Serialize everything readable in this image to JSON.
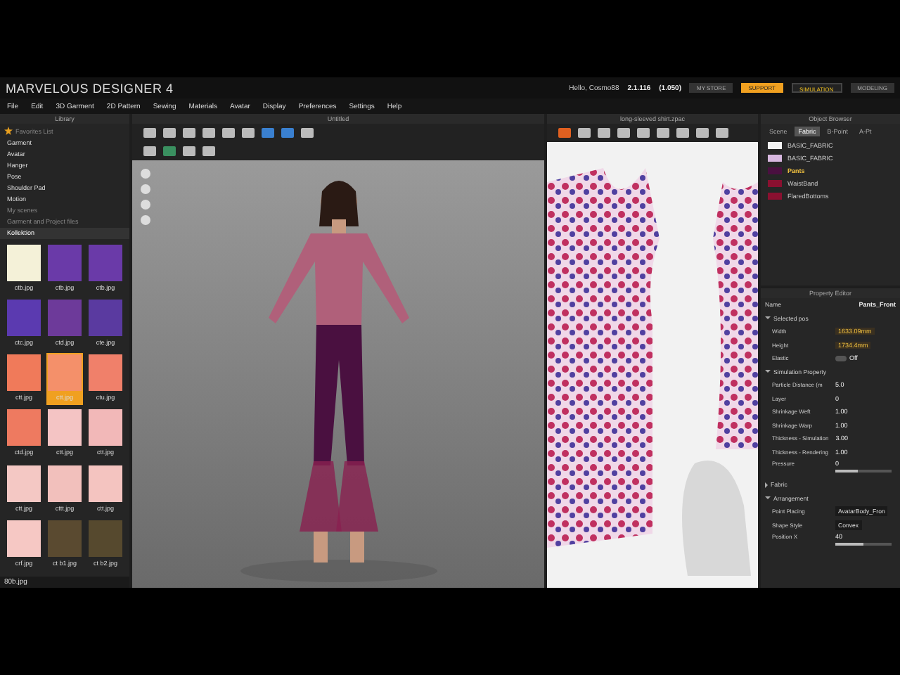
{
  "app": {
    "title": "MARVELOUS DESIGNER 4",
    "user": "Hello, Cosmo88",
    "version": "2.1.116",
    "build": "(1.050)"
  },
  "menu": [
    "File",
    "Edit",
    "3D Garment",
    "2D Pattern",
    "Sewing",
    "Materials",
    "Avatar",
    "Display",
    "Preferences",
    "Settings",
    "Help"
  ],
  "modes": [
    {
      "label": "MY STORE",
      "kind": "plain"
    },
    {
      "label": "SUPPORT",
      "kind": "accent"
    },
    {
      "label": "SIMULATION",
      "kind": "mode"
    },
    {
      "label": "MODELING",
      "kind": "plain"
    }
  ],
  "library": {
    "title": "Library",
    "favorites": "Favorites List",
    "items": [
      "Garment",
      "Avatar",
      "Hanger",
      "Pose",
      "Shoulder Pad",
      "Motion",
      "My scenes",
      "Garment and Project files",
      "Kollektion"
    ],
    "thumbnails": [
      {
        "label": "ctb.jpg",
        "color": "#f4f1d8",
        "selected": false
      },
      {
        "label": "ctb.jpg",
        "color": "#6a3aa8",
        "selected": false
      },
      {
        "label": "ctb.jpg",
        "color": "#6a3aa8",
        "selected": false
      },
      {
        "label": "ctc.jpg",
        "color": "#5b3ab0",
        "selected": false
      },
      {
        "label": "ctd.jpg",
        "color": "#6d3a9a",
        "selected": false
      },
      {
        "label": "cte.jpg",
        "color": "#5a3aa0",
        "selected": false
      },
      {
        "label": "ctt.jpg",
        "color": "#f07a5a",
        "selected": false
      },
      {
        "label": "ctt.jpg",
        "color": "#f4906a",
        "selected": true
      },
      {
        "label": "ctu.jpg",
        "color": "#f0806a",
        "selected": false
      },
      {
        "label": "ctd.jpg",
        "color": "#ee7a60",
        "selected": false
      },
      {
        "label": "ctt.jpg",
        "color": "#f4c4c4",
        "selected": false
      },
      {
        "label": "ctt.jpg",
        "color": "#f2b8b8",
        "selected": false
      },
      {
        "label": "ctt.jpg",
        "color": "#f4c8c4",
        "selected": false
      },
      {
        "label": "cttt.jpg",
        "color": "#f2c0bc",
        "selected": false
      },
      {
        "label": "ctt.jpg",
        "color": "#f4c4c0",
        "selected": false
      },
      {
        "label": "crf.jpg",
        "color": "#f6c8c4",
        "selected": false
      },
      {
        "label": "ct b1.jpg",
        "color": "#5a4a30",
        "selected": false
      },
      {
        "label": "ct b2.jpg",
        "color": "#56492e",
        "selected": false
      }
    ],
    "current": "80b.jpg"
  },
  "viewport": {
    "title": "Untitled"
  },
  "pattern_view": {
    "title": "long-sleeved shirt.zpac"
  },
  "object_browser": {
    "title": "Object Browser",
    "tabs": [
      {
        "label": "Scene",
        "selected": false
      },
      {
        "label": "Fabric",
        "selected": true
      },
      {
        "label": "B-Point",
        "selected": false
      },
      {
        "label": "A-Pt",
        "selected": false
      }
    ],
    "fabrics": [
      {
        "name": "BASIC_FABRIC",
        "color": "#f4f4f4",
        "selected": false
      },
      {
        "name": "BASIC_FABRIC",
        "color": "#d8b8e0",
        "selected": false
      },
      {
        "name": "Pants",
        "color": "#4a1040",
        "selected": true
      },
      {
        "name": "WaistBand",
        "color": "#8a1030",
        "selected": false
      },
      {
        "name": "FlaredBottoms",
        "color": "#8a1030",
        "selected": false
      }
    ]
  },
  "property_editor": {
    "title": "Property Editor",
    "name_label": "Name",
    "name_value": "Pants_Front",
    "rows": [
      {
        "kind": "section",
        "label": "Selected pos",
        "expanded": true
      },
      {
        "kind": "value",
        "label": "Width",
        "value": "1633.09mm",
        "highlight": true
      },
      {
        "kind": "value",
        "label": "Height",
        "value": "1734.4mm",
        "highlight": true
      },
      {
        "kind": "toggle",
        "label": "Elastic",
        "value": "Off",
        "on": false
      },
      {
        "kind": "section",
        "label": "Simulation Property",
        "expanded": true
      },
      {
        "kind": "value",
        "label": "Particle Distance (m",
        "value": "5.0",
        "highlight": false
      },
      {
        "kind": "value",
        "label": "Layer",
        "value": "0",
        "highlight": false
      },
      {
        "kind": "value",
        "label": "Shrinkage Weft",
        "value": "1.00",
        "highlight": false
      },
      {
        "kind": "value",
        "label": "Shrinkage Warp",
        "value": "1.00",
        "highlight": false
      },
      {
        "kind": "value",
        "label": "Thickness - Simulation",
        "value": "3.00",
        "highlight": false
      },
      {
        "kind": "value",
        "label": "Thickness - Rendering",
        "value": "1.00",
        "highlight": false
      },
      {
        "kind": "slider",
        "label": "Pressure",
        "value": "0",
        "level": 0.4
      },
      {
        "kind": "section",
        "label": "Fabric",
        "expanded": false
      },
      {
        "kind": "section",
        "label": "Arrangement",
        "expanded": true
      },
      {
        "kind": "select",
        "label": "Point Placing",
        "value": "AvatarBody_Fron"
      },
      {
        "kind": "select",
        "label": "Shape Style",
        "value": "Convex"
      },
      {
        "kind": "slider",
        "label": "Position X",
        "value": "40",
        "level": 0.5
      }
    ]
  }
}
